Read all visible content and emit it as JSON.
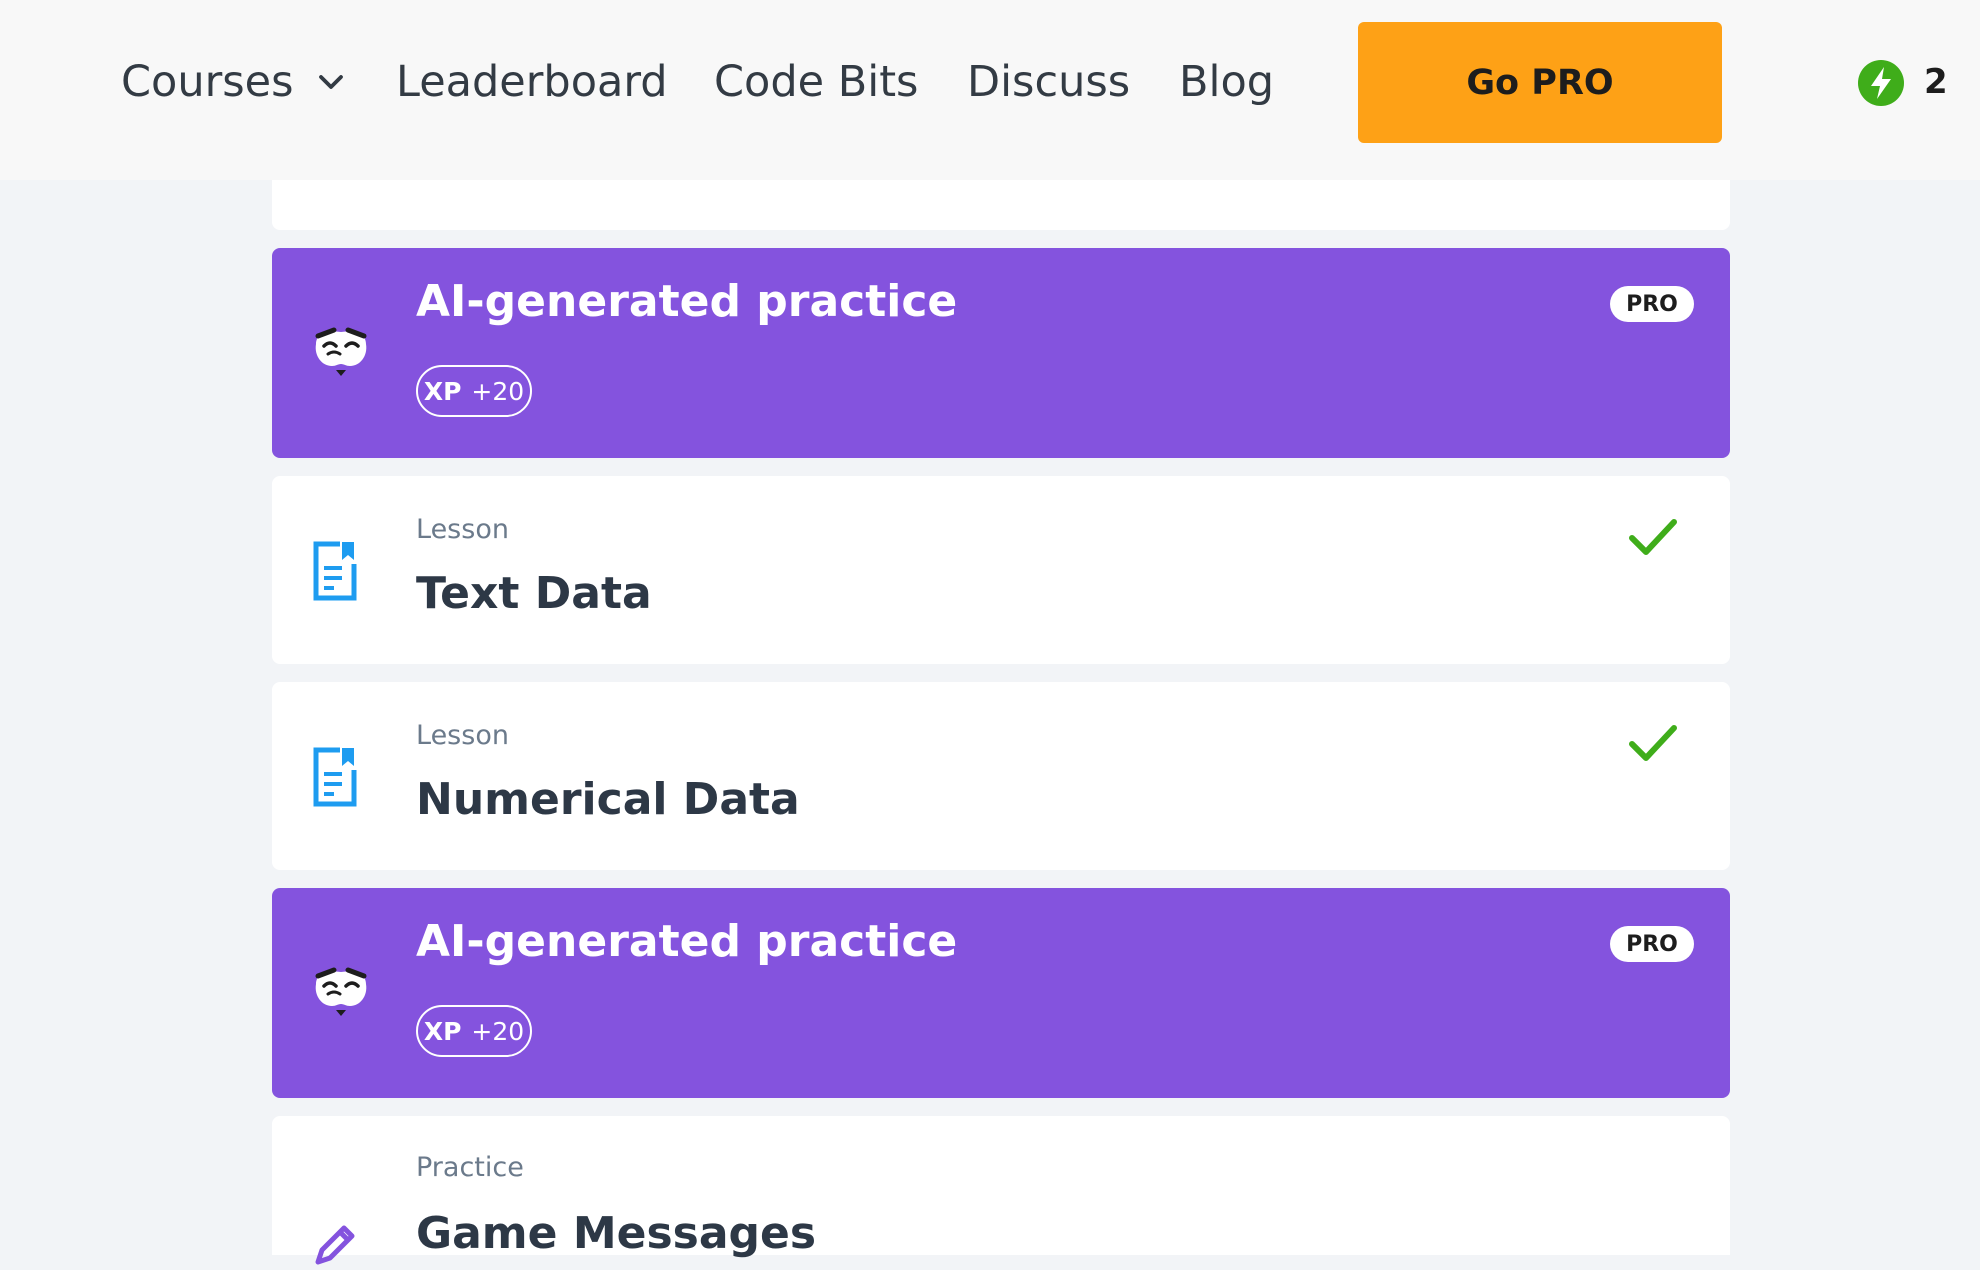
{
  "nav": {
    "courses": "Courses",
    "leaderboard": "Leaderboard",
    "code_bits": "Code Bits",
    "discuss": "Discuss",
    "blog": "Blog",
    "go_pro": "Go PRO",
    "bolt_count": "2"
  },
  "colors": {
    "accent_orange": "#fea116",
    "ai_purple": "#8453de",
    "check_green": "#3fad1a",
    "bolt_green": "#3fad1a",
    "lesson_blue": "#1e9cf0"
  },
  "cards": [
    {
      "kind": "",
      "title": "",
      "icon": "lesson-icon"
    },
    {
      "kind": "",
      "title": "AI-generated practice",
      "xp_label": "XP",
      "xp_value": "+20",
      "badge": "PRO",
      "icon": "ai-practice-icon"
    },
    {
      "kind": "Lesson",
      "title": "Text Data",
      "completed": true,
      "icon": "lesson-icon"
    },
    {
      "kind": "Lesson",
      "title": "Numerical Data",
      "completed": true,
      "icon": "lesson-icon"
    },
    {
      "kind": "",
      "title": "AI-generated practice",
      "xp_label": "XP",
      "xp_value": "+20",
      "badge": "PRO",
      "icon": "ai-practice-icon"
    },
    {
      "kind": "Practice",
      "title": "Game Messages",
      "icon": "pencil-icon"
    }
  ]
}
